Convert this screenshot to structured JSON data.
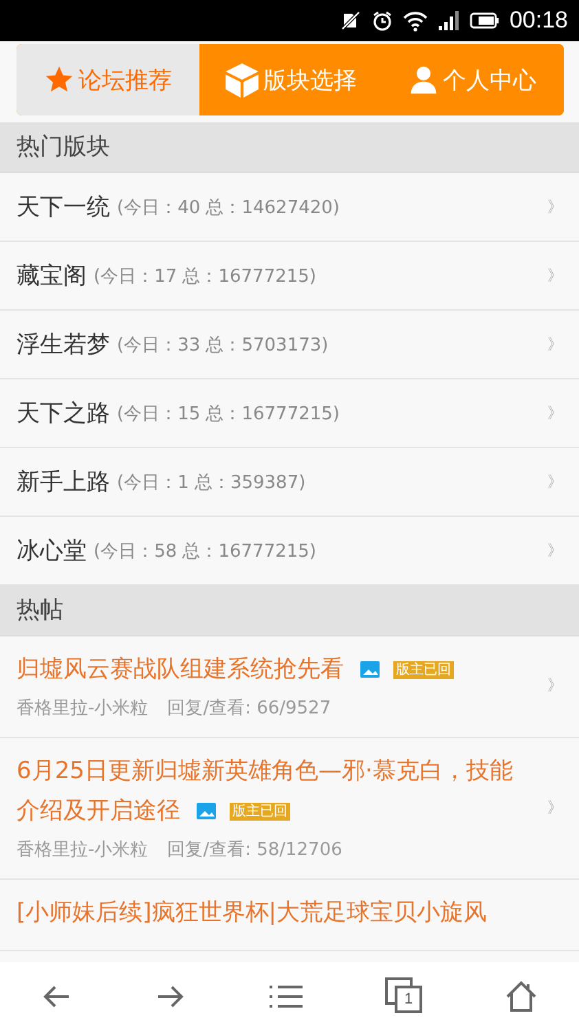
{
  "status_bar": {
    "time": "00:18"
  },
  "tabs": [
    {
      "label": "论坛推荐",
      "selected": true
    },
    {
      "label": "版块选择",
      "selected": false
    },
    {
      "label": "个人中心",
      "selected": false
    }
  ],
  "hot_boards": {
    "title": "热门版块",
    "items": [
      {
        "name": "天下一统",
        "stats": "(今日：40 总：14627420)",
        "chevron": "》"
      },
      {
        "name": "藏宝阁",
        "stats": "(今日：17 总：16777215)",
        "chevron": "》"
      },
      {
        "name": "浮生若梦",
        "stats": "(今日：33 总：5703173)",
        "chevron": "》"
      },
      {
        "name": "天下之路",
        "stats": "(今日：15 总：16777215)",
        "chevron": "》"
      },
      {
        "name": "新手上路",
        "stats": "(今日：1 总：359387)",
        "chevron": "》"
      },
      {
        "name": "冰心堂",
        "stats": "(今日：58 总：16777215)",
        "chevron": "》"
      }
    ]
  },
  "hot_posts": {
    "title": "热帖",
    "items": [
      {
        "title": "归墟风云赛战队组建系统抢先看",
        "has_image": true,
        "badge": "版主已回",
        "author": "香格里拉-小米粒",
        "replies_views": "回复/查看: 66/9527",
        "chevron": "》"
      },
      {
        "title": "6月25日更新归墟新英雄角色—邪·慕克白，技能介绍及开启途径",
        "has_image": true,
        "badge": "版主已回",
        "author": "香格里拉-小米粒",
        "replies_views": "回复/查看: 58/12706",
        "chevron": "》"
      },
      {
        "title": "[小师妹后续]疯狂世界杯|大荒足球宝贝小旋风"
      }
    ]
  },
  "bottom_nav": {
    "tab_count": "1"
  }
}
